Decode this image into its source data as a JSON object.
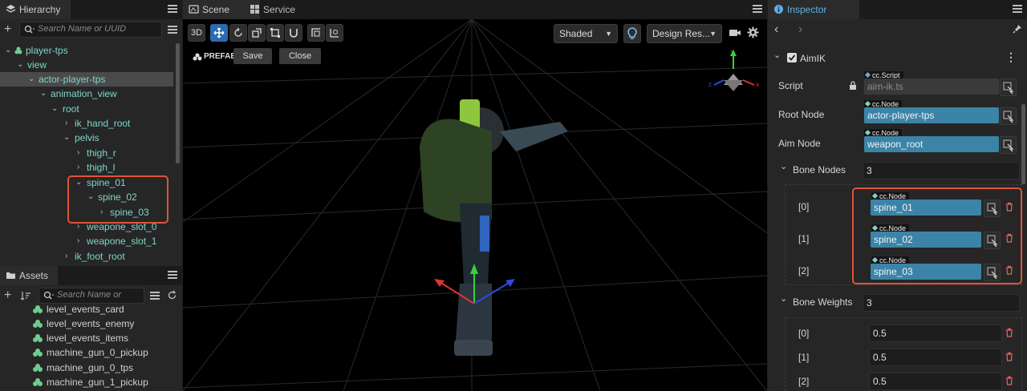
{
  "hierarchy": {
    "title": "Hierarchy",
    "search_placeholder": "Search Name or UUID",
    "rows": [
      {
        "label": "player-tps",
        "chev": "⌄"
      },
      {
        "label": "view",
        "chev": "⌄"
      },
      {
        "label": "actor-player-tps",
        "chev": "⌄"
      },
      {
        "label": "animation_view",
        "chev": "⌄"
      },
      {
        "label": "root",
        "chev": "⌄"
      },
      {
        "label": "ik_hand_root",
        "chev": "›"
      },
      {
        "label": "pelvis",
        "chev": "⌄"
      },
      {
        "label": "thigh_r",
        "chev": "›"
      },
      {
        "label": "thigh_l",
        "chev": "›"
      },
      {
        "label": "spine_01",
        "chev": "⌄"
      },
      {
        "label": "spine_02",
        "chev": "⌄"
      },
      {
        "label": "spine_03",
        "chev": "›"
      },
      {
        "label": "weapone_slot_0",
        "chev": "›"
      },
      {
        "label": "weapone_slot_1",
        "chev": "›"
      },
      {
        "label": "ik_foot_root",
        "chev": "›"
      }
    ]
  },
  "assets": {
    "title": "Assets",
    "search_placeholder": "Search Name or",
    "items": [
      "level_events_card",
      "level_events_enemy",
      "level_events_items",
      "machine_gun_0_pickup",
      "machine_gun_0_tps",
      "machine_gun_1_pickup"
    ]
  },
  "scene": {
    "tab_scene": "Scene",
    "tab_service": "Service",
    "btn_3d": "3D",
    "shading": "Shaded",
    "resolution": "Design Res...",
    "prefab_label": "PREFAB",
    "save_label": "Save",
    "close_label": "Close"
  },
  "inspector": {
    "title": "Inspector",
    "component": "AimIK",
    "component_enabled": true,
    "script_label": "Script",
    "script_tag": "cc.Script",
    "script_value": "aim-ik.ts",
    "root_label": "Root Node",
    "root_tag": "cc.Node",
    "root_value": "actor-player-tps",
    "aim_label": "Aim Node",
    "aim_tag": "cc.Node",
    "aim_value": "weapon_root",
    "bone_nodes_label": "Bone Nodes",
    "bone_nodes_count": "3",
    "bone_nodes": [
      {
        "index": "[0]",
        "tag": "cc.Node",
        "value": "spine_01"
      },
      {
        "index": "[1]",
        "tag": "cc.Node",
        "value": "spine_02"
      },
      {
        "index": "[2]",
        "tag": "cc.Node",
        "value": "spine_03"
      }
    ],
    "bone_weights_label": "Bone Weights",
    "bone_weights_count": "3",
    "bone_weights": [
      {
        "index": "[0]",
        "value": "0.5"
      },
      {
        "index": "[1]",
        "value": "0.5"
      },
      {
        "index": "[2]",
        "value": "0.5"
      }
    ]
  },
  "colors": {
    "node_field": "#3b84a8",
    "highlight": "#e0533a",
    "tree_text": "#7fd5c8",
    "active_tool": "#2b6cb0"
  }
}
